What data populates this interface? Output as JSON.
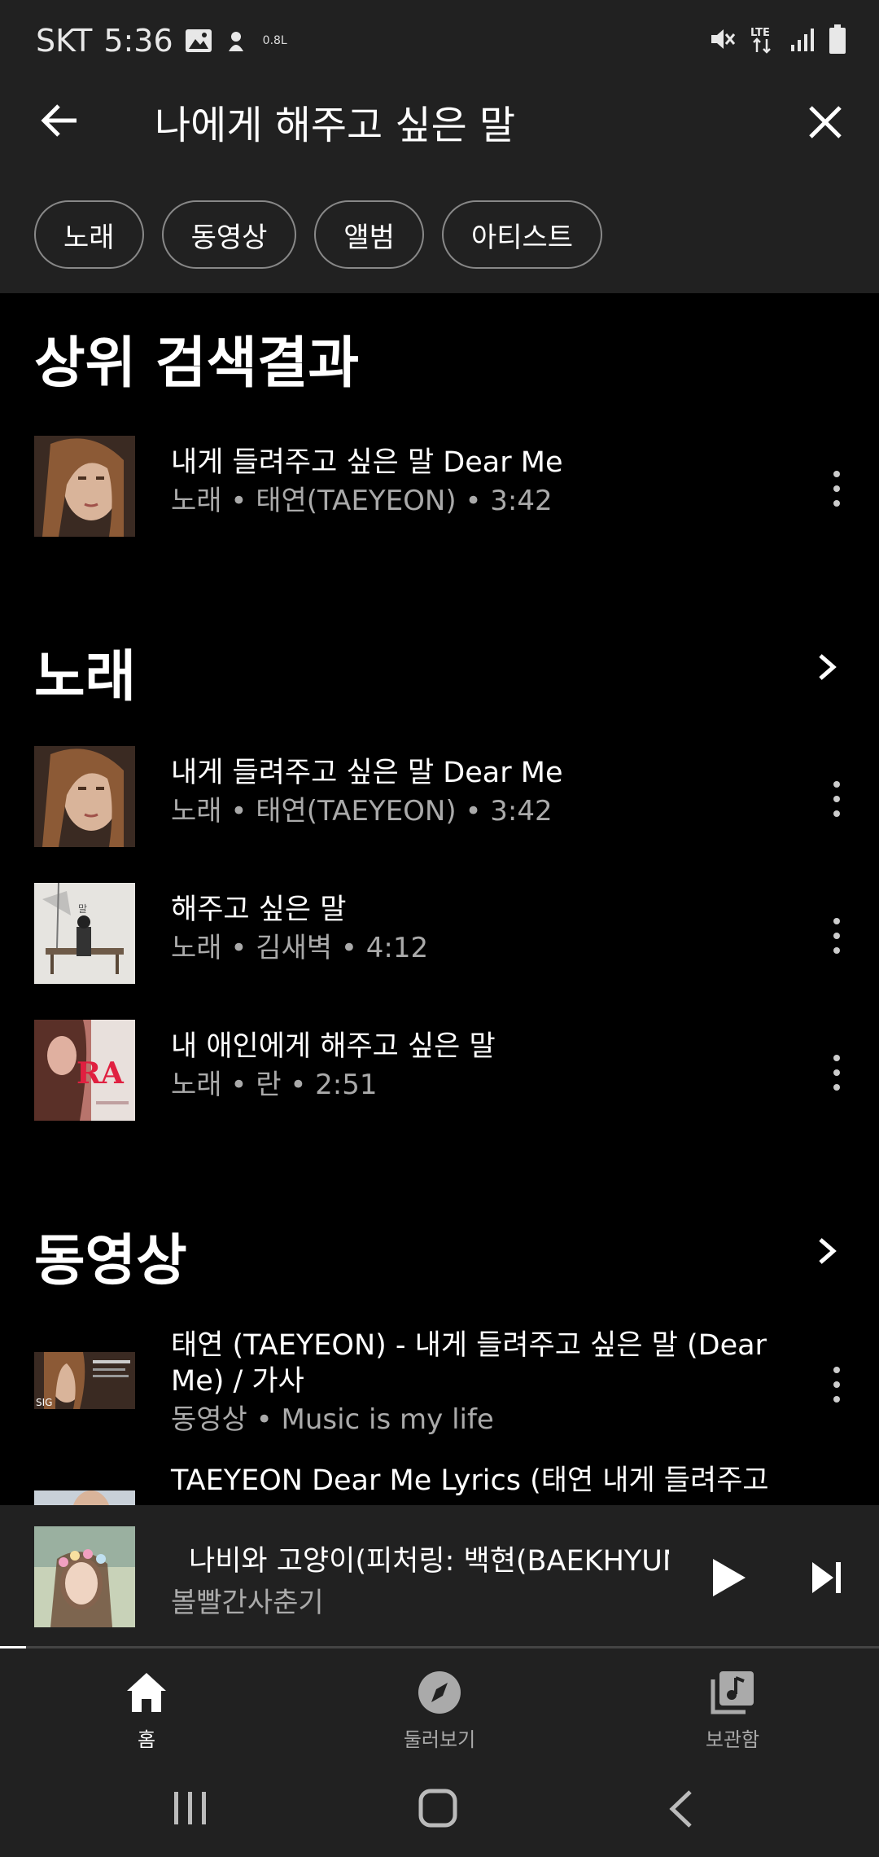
{
  "status_bar": {
    "carrier": "SKT",
    "time": "5:36",
    "speed": "0.8L"
  },
  "search": {
    "query": "나에게 해주고 싶은 말"
  },
  "filter_chips": [
    "노래",
    "동영상",
    "앨범",
    "아티스트"
  ],
  "top_result": {
    "heading": "상위 검색결과",
    "item": {
      "title": "내게 들려주고 싶은 말 Dear Me",
      "subtitle": "노래 • 태연(TAEYEON) • 3:42"
    }
  },
  "songs": {
    "heading": "노래",
    "items": [
      {
        "title": "내게 들려주고 싶은 말 Dear Me",
        "subtitle": "노래 • 태연(TAEYEON) • 3:42"
      },
      {
        "title": "해주고 싶은 말",
        "subtitle": "노래 • 김새벽 • 4:12"
      },
      {
        "title": "내 애인에게 해주고 싶은 말",
        "subtitle": "노래 • 란 • 2:51"
      }
    ]
  },
  "videos": {
    "heading": "동영상",
    "items": [
      {
        "title": "태연 (TAEYEON) - 내게 들려주고 싶은 말 (Dear Me) / 가사",
        "subtitle": "동영상 • Music is my life"
      },
      {
        "title": "TAEYEON Dear Me Lyrics (태연 내게 들려주고",
        "subtitle": ""
      }
    ]
  },
  "mini_player": {
    "title": "나비와 고양이(피처링: 백현(BAEKHYUN",
    "artist": "볼빨간사춘기",
    "progress": 0.03
  },
  "bottom_nav": {
    "home": "홈",
    "explore": "둘러보기",
    "library": "보관함"
  }
}
